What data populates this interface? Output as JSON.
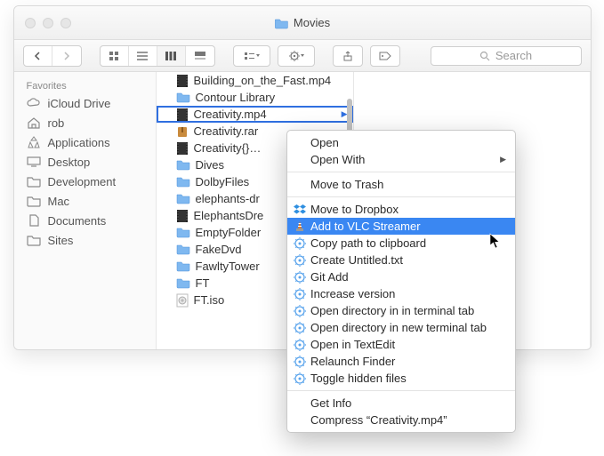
{
  "window": {
    "title": "Movies"
  },
  "sidebar": {
    "heading": "Favorites",
    "items": [
      {
        "label": "iCloud Drive",
        "icon": "cloud"
      },
      {
        "label": "rob",
        "icon": "home"
      },
      {
        "label": "Applications",
        "icon": "app"
      },
      {
        "label": "Desktop",
        "icon": "desktop"
      },
      {
        "label": "Development",
        "icon": "folder"
      },
      {
        "label": "Mac",
        "icon": "folder"
      },
      {
        "label": "Documents",
        "icon": "doc"
      },
      {
        "label": "Sites",
        "icon": "folder"
      }
    ]
  },
  "search": {
    "placeholder": "Search"
  },
  "files": [
    {
      "name": "Building_on_the_Fast.mp4",
      "type": "video",
      "truncated": true
    },
    {
      "name": "Contour Library",
      "type": "folder"
    },
    {
      "name": "Creativity.mp4",
      "type": "video",
      "selected": true
    },
    {
      "name": "Creativity.rar",
      "type": "archive",
      "truncated": true
    },
    {
      "name": "Creativity{}…",
      "type": "video"
    },
    {
      "name": "Dives",
      "type": "folder"
    },
    {
      "name": "DolbyFiles",
      "type": "folder"
    },
    {
      "name": "elephants-dr",
      "type": "folder",
      "truncated": true
    },
    {
      "name": "ElephantsDre",
      "type": "video",
      "truncated": true
    },
    {
      "name": "EmptyFolder",
      "type": "folder",
      "truncated": true
    },
    {
      "name": "FakeDvd",
      "type": "folder"
    },
    {
      "name": "FawltyTower",
      "type": "folder",
      "truncated": true
    },
    {
      "name": "FT",
      "type": "folder"
    },
    {
      "name": "FT.iso",
      "type": "iso"
    }
  ],
  "contextMenu": {
    "groups": [
      [
        {
          "label": "Open"
        },
        {
          "label": "Open With",
          "submenu": true
        }
      ],
      [
        {
          "label": "Move to Trash"
        }
      ],
      [
        {
          "label": "Move to Dropbox",
          "icon": "dropbox"
        },
        {
          "label": "Add to VLC Streamer",
          "icon": "vlc",
          "highlighted": true
        },
        {
          "label": "Copy path to clipboard",
          "icon": "service"
        },
        {
          "label": "Create Untitled.txt",
          "icon": "service"
        },
        {
          "label": "Git Add",
          "icon": "service"
        },
        {
          "label": "Increase version",
          "icon": "service"
        },
        {
          "label": "Open directory in in terminal tab",
          "icon": "service"
        },
        {
          "label": "Open directory in new terminal tab",
          "icon": "service"
        },
        {
          "label": "Open in TextEdit",
          "icon": "service"
        },
        {
          "label": "Relaunch Finder",
          "icon": "service"
        },
        {
          "label": "Toggle hidden files",
          "icon": "service"
        }
      ],
      [
        {
          "label": "Get Info"
        },
        {
          "label": "Compress “Creativity.mp4”"
        }
      ]
    ]
  }
}
